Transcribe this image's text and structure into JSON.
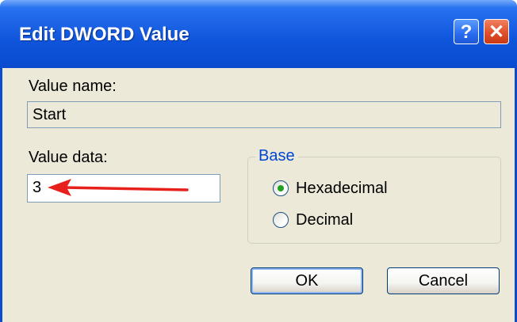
{
  "window": {
    "title": "Edit DWORD Value",
    "help_glyph": "?",
    "close_glyph": "✕"
  },
  "value_name": {
    "label": "Value name:",
    "value": "Start"
  },
  "value_data": {
    "label": "Value data:",
    "value": "3"
  },
  "base": {
    "title": "Base",
    "options": [
      {
        "label": "Hexadecimal",
        "selected": true
      },
      {
        "label": "Decimal",
        "selected": false
      }
    ]
  },
  "buttons": {
    "ok_label": "OK",
    "cancel_label": "Cancel"
  },
  "annotation": {
    "arrow_color": "#e8201c",
    "icon": "left-arrow-icon"
  },
  "colors": {
    "titlebar_accent": "#0a4bcf",
    "dialog_background": "#ece9d8",
    "group_title": "#0046d5",
    "close_button": "#e0502a",
    "radio_selected": "#21a121"
  }
}
